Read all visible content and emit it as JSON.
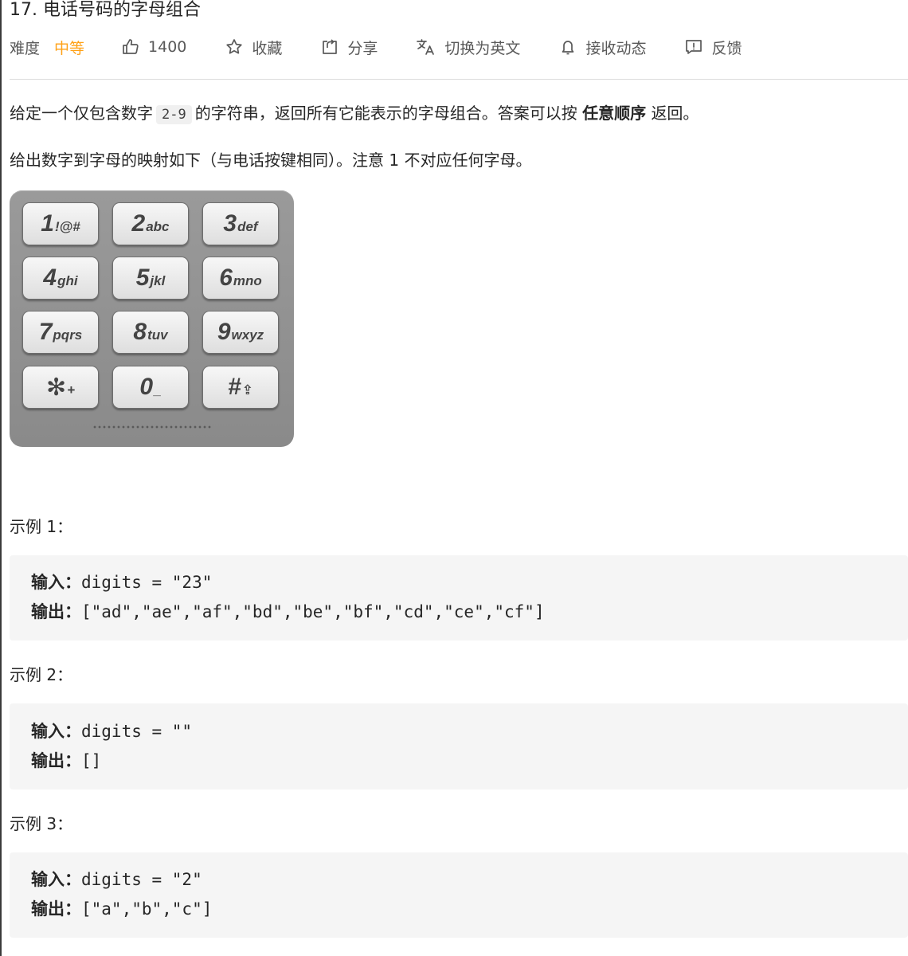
{
  "problem": {
    "title": "17. 电话号码的字母组合"
  },
  "meta": {
    "difficulty_label": "难度",
    "difficulty_value": "中等",
    "likes": "1400",
    "favorite_label": "收藏",
    "share_label": "分享",
    "switch_lang_label": "切换为英文",
    "notify_label": "接收动态",
    "feedback_label": "反馈"
  },
  "colors": {
    "difficulty_medium": "#ffa116"
  },
  "description": {
    "p1_before": "给定一个仅包含数字",
    "p1_code": "2-9",
    "p1_middle": "的字符串，返回所有它能表示的字母组合。答案可以按",
    "p1_bold": "任意顺序",
    "p1_after": "返回。",
    "p2": "给出数字到字母的映射如下（与电话按键相同）。注意 1 不对应任何字母。"
  },
  "keypad": {
    "keys": [
      {
        "num": "1",
        "sub": "!@#"
      },
      {
        "num": "2",
        "sub": "abc"
      },
      {
        "num": "3",
        "sub": "def"
      },
      {
        "num": "4",
        "sub": "ghi"
      },
      {
        "num": "5",
        "sub": "jkl"
      },
      {
        "num": "6",
        "sub": "mno"
      },
      {
        "num": "7",
        "sub": "pqrs"
      },
      {
        "num": "8",
        "sub": "tuv"
      },
      {
        "num": "9",
        "sub": "wxyz"
      },
      {
        "num": "✻",
        "sub": "+"
      },
      {
        "num": "0",
        "sub": "_"
      },
      {
        "num": "#",
        "sub": "⇪"
      }
    ]
  },
  "examples": [
    {
      "label": "示例 1：",
      "input_label": "输入：",
      "input": "digits = \"23\"",
      "output_label": "输出：",
      "output": "[\"ad\",\"ae\",\"af\",\"bd\",\"be\",\"bf\",\"cd\",\"ce\",\"cf\"]"
    },
    {
      "label": "示例 2：",
      "input_label": "输入：",
      "input": "digits = \"\"",
      "output_label": "输出：",
      "output": "[]"
    },
    {
      "label": "示例 3：",
      "input_label": "输入：",
      "input": "digits = \"2\"",
      "output_label": "输出：",
      "output": "[\"a\",\"b\",\"c\"]"
    }
  ]
}
